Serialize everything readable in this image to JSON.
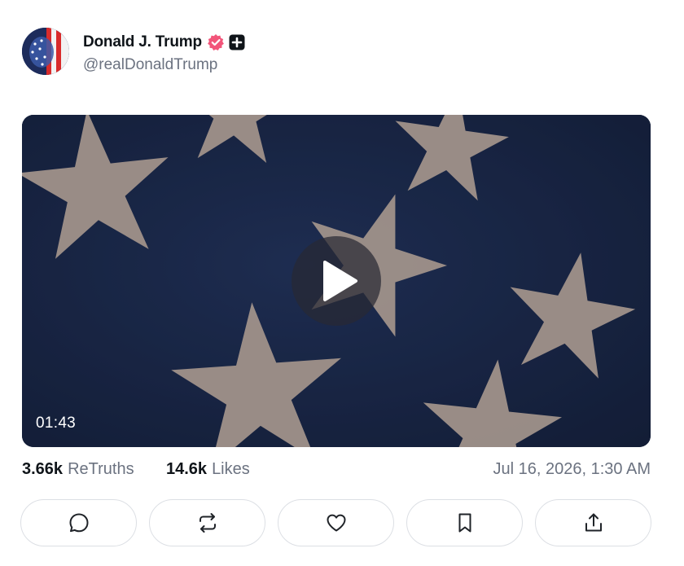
{
  "author": {
    "display_name": "Donald J. Trump",
    "handle": "@realDonaldTrump",
    "verified_icon": "verified-badge-icon",
    "plus_icon": "plus-square-icon"
  },
  "media": {
    "duration": "01:43",
    "play_icon": "play-icon"
  },
  "stats": {
    "retruths_count": "3.66k",
    "retruths_label": "ReTruths",
    "likes_count": "14.6k",
    "likes_label": "Likes",
    "timestamp": "Jul 16, 2026, 1:30 AM"
  },
  "actions": [
    {
      "name": "reply",
      "icon": "comment-icon"
    },
    {
      "name": "retruth",
      "icon": "repost-icon"
    },
    {
      "name": "like",
      "icon": "heart-icon"
    },
    {
      "name": "bookmark",
      "icon": "bookmark-icon"
    },
    {
      "name": "share",
      "icon": "share-icon"
    }
  ],
  "colors": {
    "verified": "#f2557a",
    "text_primary": "#0f1419",
    "text_secondary": "#6b7280",
    "border": "#dcdfe4",
    "media_bg": "#1b2a47"
  }
}
